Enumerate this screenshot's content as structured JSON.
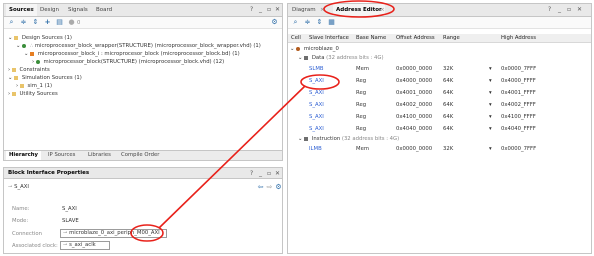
{
  "sources": {
    "tabs": [
      "Sources",
      "Design",
      "Signals",
      "Board"
    ],
    "close_glyph": "×",
    "help_glyph": "?",
    "toolbar_count": "0",
    "tree": [
      {
        "label": "Design Sources (1)"
      },
      {
        "label": "microprocessor_block_wrapper(STRUCTURE) (microprocessor_block_wrapper.vhd) (1)",
        "name": "microprocessor_block_wrapper"
      },
      {
        "label": "microprocessor_block_i : microprocesor_block (microprocessor_block.bd) (1)",
        "name": "microprocessor_block_i : microprocesor_block"
      },
      {
        "label": "microprocessor_block(STRUCTURE) (microprocessor_block.vhd) (12)",
        "name": "microprocessor_block"
      },
      {
        "label": "Constraints"
      },
      {
        "label": "Simulation Sources (1)"
      },
      {
        "label": "sim_1 (1)"
      },
      {
        "label": "Utility Sources"
      }
    ],
    "bottom_tabs": [
      "Hierarchy",
      "IP Sources",
      "Libraries",
      "Compile Order"
    ]
  },
  "properties": {
    "title": "Block Interface Properties",
    "object_name": "S_AXI",
    "fields": [
      {
        "label": "Name:",
        "value": "S_AXI"
      },
      {
        "label": "Mode:",
        "value": "SLAVE"
      },
      {
        "label": "Connection",
        "value": "microblaze_0_axi_periph_M00_AXI"
      },
      {
        "label": "Associated clock:",
        "value": "s_axi_aclk"
      }
    ]
  },
  "address_editor": {
    "tabs": [
      "Diagram",
      "Address Editor"
    ],
    "columns": [
      "Cell",
      "Slave Interface",
      "Base Name",
      "Offset Address",
      "Range",
      "High Address"
    ],
    "root": "microblaze_0",
    "groups": [
      {
        "label": "Data",
        "meta": "(32 address bits : 4G)",
        "rows": [
          {
            "iface": "SLMB",
            "base": "Mem",
            "offset": "0x0000_0000",
            "range": "32K",
            "high": "0x0000_7FFF"
          },
          {
            "iface": "S_AXI",
            "base": "Reg",
            "offset": "0x4000_0000",
            "range": "64K",
            "high": "0x4000_FFFF"
          },
          {
            "iface": "S_AXI",
            "base": "Reg",
            "offset": "0x4001_0000",
            "range": "64K",
            "high": "0x4001_FFFF"
          },
          {
            "iface": "S_AXI",
            "base": "Reg",
            "offset": "0x4002_0000",
            "range": "64K",
            "high": "0x4002_FFFF"
          },
          {
            "iface": "S_AXI",
            "base": "Reg",
            "offset": "0x4100_0000",
            "range": "64K",
            "high": "0x4100_FFFF"
          },
          {
            "iface": "S_AXI",
            "base": "Reg",
            "offset": "0x4040_0000",
            "range": "64K",
            "high": "0x4040_FFFF"
          }
        ]
      },
      {
        "label": "Instruction",
        "meta": "(32 address bits : 4G)",
        "rows": [
          {
            "iface": "ILMB",
            "base": "Mem",
            "offset": "0x0000_0000",
            "range": "32K",
            "high": "0x0000_7FFF"
          }
        ]
      }
    ]
  },
  "colors": {
    "annotation": "#e8211a",
    "link": "#2d5fd3",
    "tab_bg": "#e9e9e9"
  }
}
